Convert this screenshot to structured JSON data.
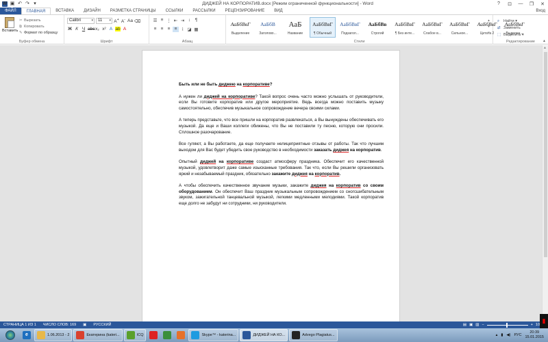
{
  "titlebar": {
    "title": "ДИДЖЕЙ НА КОРПОРАТИВ.docx [Режим ограниченной функциональности] - Word",
    "help": "?",
    "minimize": "—",
    "restore": "❐",
    "close": "✕"
  },
  "tabs": [
    "ФАЙЛ",
    "ГЛАВНАЯ",
    "ВСТАВКА",
    "ДИЗАЙН",
    "РАЗМЕТКА СТРАНИЦЫ",
    "ССЫЛКИ",
    "РАССЫЛКИ",
    "РЕЦЕНЗИРОВАНИЕ",
    "ВИД"
  ],
  "user": "Вход",
  "clipboard": {
    "paste": "Вставить",
    "cut": "Вырезать",
    "copy": "Копировать",
    "format_painter": "Формат по образцу",
    "label": "Буфер обмена"
  },
  "font": {
    "name": "Calibri",
    "size": "11",
    "label": "Шрифт"
  },
  "paragraph": {
    "label": "Абзац"
  },
  "styles": {
    "label": "Стили",
    "items": [
      {
        "sample": "АаБбВвГ",
        "name": "Выделение"
      },
      {
        "sample": "АаБбВ",
        "name": "Заголово..."
      },
      {
        "sample": "АаБ",
        "name": "Название"
      },
      {
        "sample": "АаБбВвГ",
        "name": "¶ Обычный"
      },
      {
        "sample": "АаБбВвГ",
        "name": "Подзагол..."
      },
      {
        "sample": "АаБбВв",
        "name": "Строгий"
      },
      {
        "sample": "АаБбВвГ",
        "name": "¶ Без инте..."
      },
      {
        "sample": "АаБбВвГ",
        "name": "Слабое в..."
      },
      {
        "sample": "АаБбВвГ",
        "name": "Сильное..."
      },
      {
        "sample": "АаБбВвГ",
        "name": "Цитата 2"
      },
      {
        "sample": "АаБбВвГ",
        "name": "Выделен..."
      }
    ]
  },
  "editing": {
    "find": "Найти",
    "replace": "Заменить",
    "select": "Выделить",
    "label": "Редактирование"
  },
  "document": {
    "title_parts": [
      "Быть или не быть ",
      "диджею",
      " на ",
      "корпоративе",
      "?"
    ],
    "p1": [
      "А нужен ли ",
      "диджей на корпоративе",
      "? Такой вопрос очень часто можно услышать от руководители, если Вы готовите корпоратив или другое мероприятие. Ведь всегда можно поставить музыку самостоятельно, обеспечив музыкальное сопровождение вечера своими силами."
    ],
    "p2": "А теперь представьте, что все пришли на корпоратив развлекаться, а Вы вынуждены обеспечивать его музыкой. Да еще и Ваши коллеги обижены, что Вы не поставили ту песню, которую они просили. Сплошное разочарование.",
    "p3": [
      "Все гуляют, а Вы работаете, да еще получаете нелицеприятные отзывы от работы. Так что лучшим выходом для Вас будет убедить свое руководство в необходимости ",
      "заказать ",
      "диджея",
      " на корпоратив",
      "."
    ],
    "p4": [
      "Опытный ",
      "диджей",
      " на ",
      "корпоративе",
      " создаст атмосферу праздника. Обеспечит его качественной музыкой, удовлетворит даже самые изысканные требования. Так что, если Вы решили организовать яркий и незабываемый праздник, обязательно ",
      "закажите ",
      "диджея",
      " на ",
      "корпоратив",
      "."
    ],
    "p5": [
      "А чтобы обеспечить качественное звучание музыки, закажите ",
      "диджея",
      " на ",
      "корпоратив",
      " со своим оборудованием",
      ". Он обеспечит Ваш праздник музыкальным сопровождением со сногсшибательным звуком, зажигательной танцевальной музыкой, легкими медленными мелодиями. Такой корпоратив еще долго не забудут ни сотрудники, ни руководители."
    ]
  },
  "status": {
    "page": "СТРАНИЦА 1 ИЗ 1",
    "words": "ЧИСЛО СЛОВ: 169",
    "lang": "РУССКИЙ",
    "zoom": "100%"
  },
  "taskbar": {
    "items": [
      {
        "label": "1.06.2013 - 2",
        "icon": "folder-icon",
        "color": "#e8b84a"
      },
      {
        "label": "Екатерина (kateri...",
        "icon": "chrome-icon",
        "color": "#d9412f"
      },
      {
        "label": "ICQ",
        "icon": "icq-icon",
        "color": "#5aa02c"
      },
      {
        "label": "",
        "icon": "yandex-icon",
        "color": "#d22"
      },
      {
        "label": "",
        "icon": "chrome2-icon",
        "color": "#3b8f3b"
      },
      {
        "label": "",
        "icon": "firefox-icon",
        "color": "#e6712a"
      },
      {
        "label": "Skype™ - katerina...",
        "icon": "skype-icon",
        "color": "#1e9be0"
      },
      {
        "label": "ДИДЖЕЙ НА КО...",
        "icon": "word-icon",
        "color": "#2b579a"
      },
      {
        "label": "Advego Plagiatus...",
        "icon": "advego-icon",
        "color": "#222"
      }
    ],
    "lang": "РУС",
    "time": "20:39",
    "date": "15.01.2015"
  }
}
